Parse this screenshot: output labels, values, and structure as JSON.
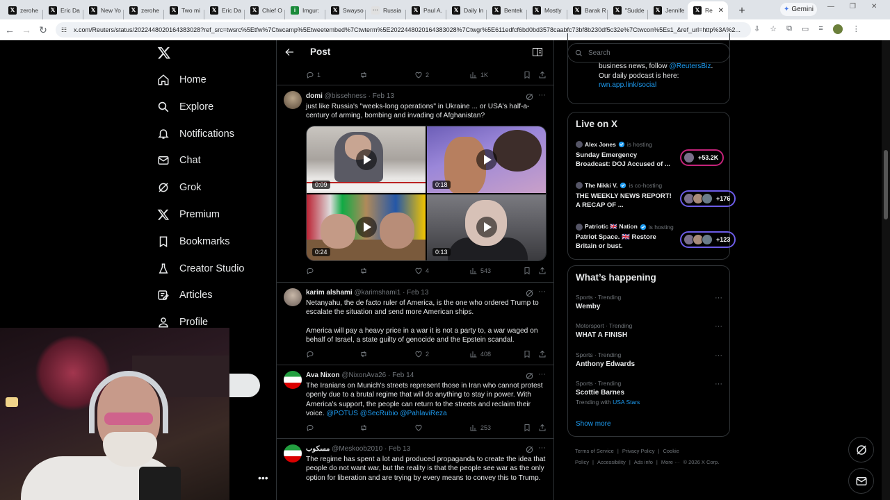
{
  "browser": {
    "tabs": [
      {
        "label": "zerohe",
        "fav": "X"
      },
      {
        "label": "Eric Da",
        "fav": "X"
      },
      {
        "label": "New Yo",
        "fav": "X"
      },
      {
        "label": "zerohe",
        "fav": "X"
      },
      {
        "label": "Two mi",
        "fav": "X"
      },
      {
        "label": "Eric Da",
        "fav": "X"
      },
      {
        "label": "Chief O",
        "fav": "X"
      },
      {
        "label": "Imgur:",
        "fav": "i"
      },
      {
        "label": "Swayso",
        "fav": "X"
      },
      {
        "label": "Russia",
        "fav": "•••"
      },
      {
        "label": "Paul A.",
        "fav": "X"
      },
      {
        "label": "Daily In",
        "fav": "X"
      },
      {
        "label": "Bentek",
        "fav": "X"
      },
      {
        "label": "Mostly",
        "fav": "X"
      },
      {
        "label": "Barak R",
        "fav": "X"
      },
      {
        "label": "\"Sudde",
        "fav": "X"
      },
      {
        "label": "Jennife",
        "fav": "X"
      },
      {
        "label": "Re",
        "fav": "X"
      }
    ],
    "new_tab": "+",
    "gemini_label": "Gemini",
    "url": "x.com/Reuters/status/2022448020164383028?ref_src=twsrc%5Etfw%7Ctwcamp%5Etweetembed%7Ctwterm%5E2022448020164383028%7Ctwgr%5E611edfcf6bd0bd3578caabfc73bf8b230df5c32e%7Ctwcon%5Es1_&ref_url=http%3A%2..."
  },
  "nav": {
    "items": [
      {
        "label": "Home",
        "icon": "home-icon"
      },
      {
        "label": "Explore",
        "icon": "search-icon"
      },
      {
        "label": "Notifications",
        "icon": "bell-icon"
      },
      {
        "label": "Chat",
        "icon": "mail-icon"
      },
      {
        "label": "Grok",
        "icon": "grok-icon"
      },
      {
        "label": "Premium",
        "icon": "x-icon"
      },
      {
        "label": "Bookmarks",
        "icon": "bookmark-icon"
      },
      {
        "label": "Creator Studio",
        "icon": "flask-icon"
      },
      {
        "label": "Articles",
        "icon": "article-icon"
      },
      {
        "label": "Profile",
        "icon": "person-icon"
      }
    ],
    "more_dots": "•••"
  },
  "post_header": {
    "title": "Post"
  },
  "top_actions": {
    "replies": "1",
    "reposts": "",
    "likes": "2",
    "views": "1K"
  },
  "tweets": [
    {
      "name": "domi",
      "handle": "@bissehness",
      "date": "Feb 13",
      "text": "just like Russia's \"weeks-long operations\" in Ukraine ... or USA's half-a-century of arming, bombing and invading of Afghanistan?",
      "videos": [
        "0:09",
        "0:18",
        "0:24",
        "0:13"
      ],
      "actions": {
        "replies": "",
        "reposts": "",
        "likes": "4",
        "views": "543"
      }
    },
    {
      "name": "karim alshami",
      "handle": "@karimshami1",
      "date": "Feb 13",
      "text": "Netanyahu, the de facto ruler of America, is the one who ordered Trump to escalate the situation and send more American ships.",
      "text2": "America will pay a heavy price in a war it is not a party to, a war waged on behalf of Israel, a state guilty of genocide and the Epstein scandal.",
      "actions": {
        "replies": "",
        "reposts": "",
        "likes": "2",
        "views": "408"
      }
    },
    {
      "name": "Ava Nixon",
      "handle": "@NixonAva26",
      "date": "Feb 14",
      "text": "The Iranians on Munich's streets represent those in Iran who cannot protest openly due to a brutal regime that will do anything to stay in power. With America's support, the people can return to the streets and reclaim their voice.",
      "mentions": [
        "@POTUS",
        "@SecRubio",
        "@PahlaviReza"
      ],
      "actions": {
        "replies": "",
        "reposts": "",
        "likes": "",
        "views": "253"
      }
    },
    {
      "name": "مسكوب",
      "handle": "@Meskoob2010",
      "date": "Feb 13",
      "text": "The regime has spent a lot and produced propaganda to create the idea that people do not want war, but the reality is that the people see war as the only option for liberation and are trying by every means to convey this to Trump."
    }
  ],
  "search": {
    "placeholder": "Search"
  },
  "about": {
    "text": "videos from Reuters. For breaking business news, follow",
    "link1": "@ReutersBiz",
    "text2": ". Our daily podcast is here:",
    "link2": "rwn.app.link/social"
  },
  "live": {
    "title": "Live on X",
    "spaces": [
      {
        "host": "Alex Jones",
        "role": "is hosting",
        "title": "Sunday Emergency Broadcast: DOJ Accused of ...",
        "count": "+53.2K"
      },
      {
        "host": "The Nikki V.",
        "role": "is co-hosting",
        "title": "THE WEEKLY NEWS REPORT! A RECAP OF ...",
        "count": "+176"
      },
      {
        "host": "Patriotic 🇬🇧 Nation",
        "role": "is hosting",
        "title": "Patriot Space. 🇬🇧 Restore Britain or bust.",
        "count": "+123"
      }
    ]
  },
  "happening": {
    "title": "What’s happening",
    "trends": [
      {
        "category": "Sports · Trending",
        "name": "Wemby"
      },
      {
        "category": "Motorsport · Trending",
        "name": "WHAT A FINISH"
      },
      {
        "category": "Sports · Trending",
        "name": "Anthony Edwards"
      },
      {
        "category": "Sports · Trending",
        "name": "Scottie Barnes",
        "with_prefix": "Trending with",
        "with_link": "USA Stars"
      }
    ],
    "show_more": "Show more"
  },
  "footer": {
    "links": [
      "Terms of Service",
      "|",
      "Privacy Policy",
      "|",
      "Cookie Policy",
      "|",
      "Accessibility",
      "|",
      "Ads info",
      "|",
      "More ···",
      "© 2026 X Corp."
    ]
  }
}
